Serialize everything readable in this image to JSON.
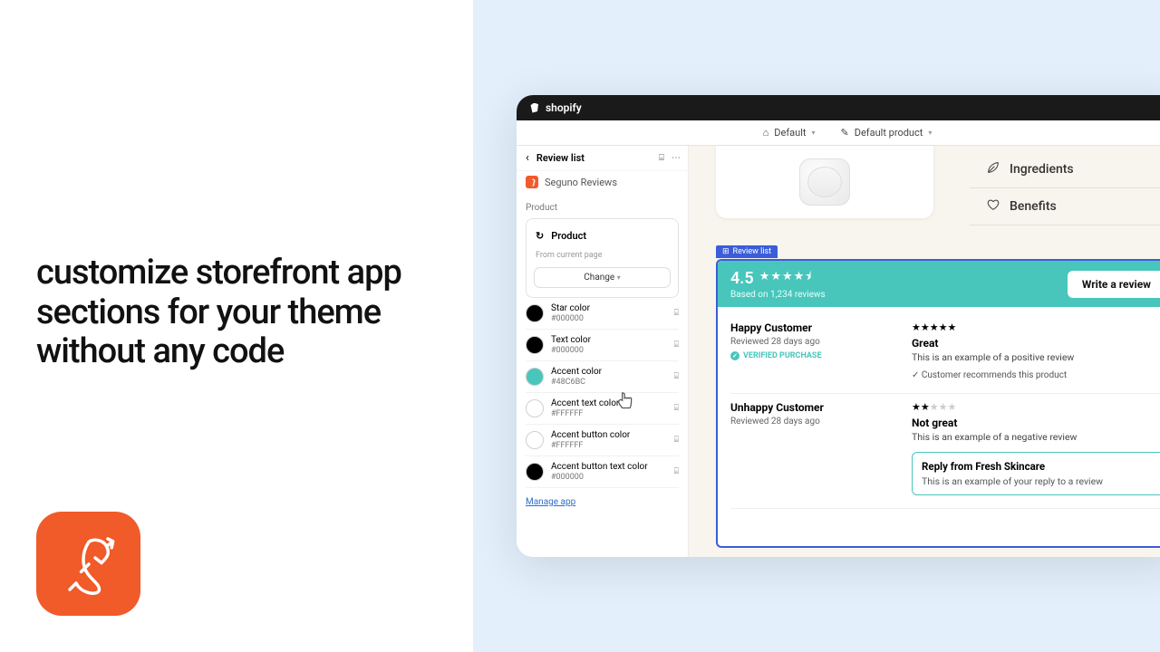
{
  "headline": "customize storefront app sections for your theme without any code",
  "topbar": {
    "brand": "shopify"
  },
  "toolbar": {
    "view_label": "Default",
    "template_label": "Default product"
  },
  "sidebar": {
    "title": "Review list",
    "app_name": "Seguno Reviews",
    "section_label": "Product",
    "product_row": "Product",
    "from_page": "From current page",
    "change_label": "Change",
    "manage_label": "Manage app",
    "colors": [
      {
        "label": "Star color",
        "hex": "#000000",
        "swatch": "#000000"
      },
      {
        "label": "Text color",
        "hex": "#000000",
        "swatch": "#000000"
      },
      {
        "label": "Accent color",
        "hex": "#48C6BC",
        "swatch": "#48C6BC"
      },
      {
        "label": "Accent text color",
        "hex": "#FFFFFF",
        "swatch": "#FFFFFF"
      },
      {
        "label": "Accent button color",
        "hex": "#FFFFFF",
        "swatch": "#FFFFFF"
      },
      {
        "label": "Accent button text color",
        "hex": "#000000",
        "swatch": "#000000"
      }
    ]
  },
  "accordion": {
    "ingredients": "Ingredients",
    "benefits": "Benefits"
  },
  "review_tag": "Review list",
  "review_header": {
    "score": "4.5",
    "stars": "★★★★⯨",
    "based": "Based on 1,234 reviews",
    "write_btn": "Write a review"
  },
  "reviews": [
    {
      "name": "Happy Customer",
      "date": "Reviewed 28 days ago",
      "verified": "VERIFIED PURCHASE",
      "stars_full": 5,
      "title": "Great",
      "body": "This is an example of a positive review",
      "recommends": "Customer recommends this product"
    },
    {
      "name": "Unhappy Customer",
      "date": "Reviewed 28 days ago",
      "stars_full": 2,
      "title": "Not great",
      "body": "This is an example of a negative review",
      "reply_title": "Reply from Fresh Skincare",
      "reply_body": "This is an example of your reply to a review"
    }
  ]
}
